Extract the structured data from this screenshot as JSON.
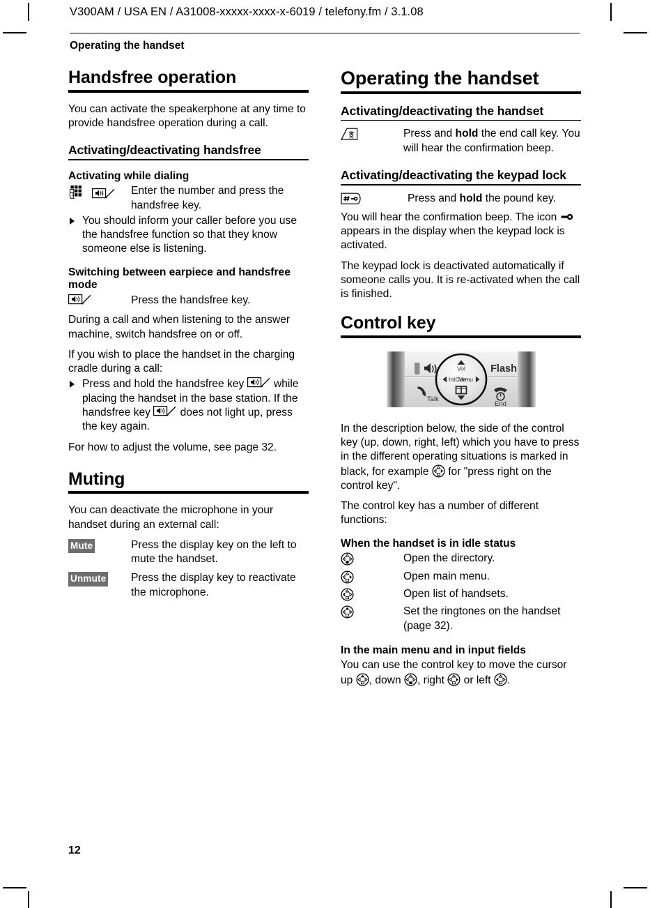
{
  "page": {
    "number": "12",
    "header_slug": "V300AM / USA EN / A31008-xxxxx-xxxx-x-6019 / telefony.fm / 3.1.08",
    "chapter": "Operating the handset",
    "badge_color": "#6e6e6e"
  },
  "left": {
    "h1": "Handsfree operation",
    "intro": "You can activate the speakerphone at any time to provide handsfree operation during a call.",
    "h2_handsfree": "Activating/deactivating handsfree",
    "h3_dialing": "Activating while dialing",
    "row_dialing": "Enter the number and press the handsfree key.",
    "bullet_inform": "You should inform your caller before you use the handsfree function so that they know someone else is listening.",
    "h3_switching": "Switching between earpiece and handsfree mode",
    "row_press_handsfree": "Press the handsfree key.",
    "para_during_call": "During a call and when listening to the answer machine, switch handsfree on or off.",
    "para_cradle": "If you wish to place the handset in the charging cradle during a call:",
    "bullet_cradle_a": "Press and hold the handsfree key ",
    "bullet_cradle_b": " while placing the handset in the base station. If the handsfree key ",
    "bullet_cradle_c": " does not light up, press the key again.",
    "para_volume": "For how to adjust the volume, see page 32.",
    "h1_muting": "Muting",
    "para_muting": "You can deactivate the microphone in your handset during an external call:",
    "key_mute": "Mute",
    "row_mute": "Press the display key on the left to mute the handset.",
    "key_unmute": "Unmute",
    "row_unmute": "Press the display key to reactivate the microphone."
  },
  "right": {
    "h1": "Operating the handset",
    "h2_activating_handset": "Activating/deactivating the handset",
    "row_endcall_a": "Press and ",
    "row_endcall_bold": "hold",
    "row_endcall_b": " the end call key. You will hear the confirmation beep.",
    "h2_keypad_lock": "Activating/deactivating the keypad lock",
    "row_pound_a": "Press and ",
    "row_pound_bold": "hold",
    "row_pound_b": " the pound key.",
    "para_lock_a": "You will hear the confirmation beep. The icon ",
    "para_lock_b": " appears in the display when the keypad lock is activated.",
    "para_lock_auto": "The keypad lock is deactivated automatically if someone calls you. It is re-activated when the call is finished.",
    "h1_control_key": "Control key",
    "photo": {
      "label_vol": "Vol",
      "label_intcom": "IntCom",
      "label_menu": "Menu",
      "label_flash": "Flash",
      "label_talk": "Talk",
      "label_end": "End"
    },
    "para_desc_a": "In the description below, the side of the control key (up, down, right, left) which you have to press in the different operating situations is marked in black, for example ",
    "para_desc_b": " for \"press right on the control key\".",
    "para_functions": "The control key has a number of different functions:",
    "h3_idle": "When the handset is in idle status",
    "idle_rows": [
      {
        "dir": "down",
        "text": "Open the directory."
      },
      {
        "dir": "right",
        "text": "Open main menu."
      },
      {
        "dir": "left",
        "text": "Open list of handsets."
      },
      {
        "dir": "up",
        "text": "Set the ringtones on the handset (page 32)."
      }
    ],
    "h3_mainmenu": "In the main menu and in input fields",
    "cursor_a": "You can use the control key to move the cursor up ",
    "cursor_b": ", down ",
    "cursor_c": ", right ",
    "cursor_d": " or left ",
    "cursor_e": "."
  }
}
